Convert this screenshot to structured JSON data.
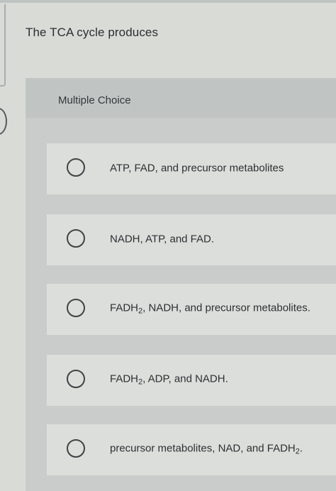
{
  "question": {
    "text": "The TCA cycle produces"
  },
  "panel": {
    "title": "Multiple Choice"
  },
  "options": [
    {
      "parts": [
        "ATP, FAD, and precursor metabolites"
      ]
    },
    {
      "parts": [
        "NADH, ATP,  and FAD."
      ]
    },
    {
      "parts": [
        "FADH",
        "2",
        ", NADH, and precursor metabolites."
      ]
    },
    {
      "parts": [
        "FADH",
        "2",
        ", ADP, and NADH."
      ]
    },
    {
      "parts": [
        "precursor metabolites, NAD, and FADH",
        "2",
        "."
      ]
    }
  ],
  "colors": {
    "page_background": "#d9dbd7",
    "panel_background": "#c9ccca",
    "option_background": "#dcdedb",
    "text": "#2c2f33",
    "radio_border": "#3f4346"
  }
}
